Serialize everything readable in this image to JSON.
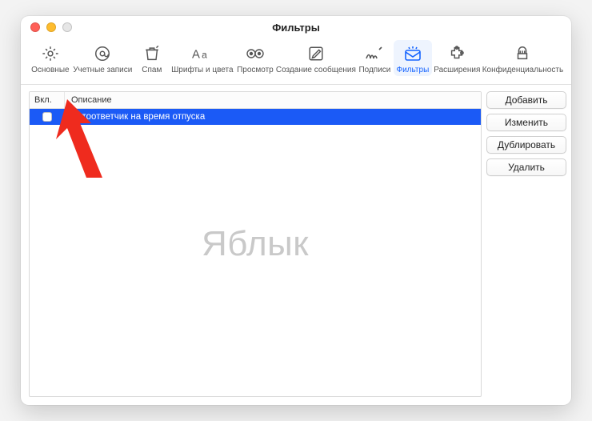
{
  "window": {
    "title": "Фильтры"
  },
  "toolbar": {
    "items": [
      {
        "id": "general",
        "label": "Основные"
      },
      {
        "id": "accounts",
        "label": "Учетные записи"
      },
      {
        "id": "junk",
        "label": "Спам"
      },
      {
        "id": "fonts",
        "label": "Шрифты и цвета"
      },
      {
        "id": "viewing",
        "label": "Просмотр"
      },
      {
        "id": "compose",
        "label": "Создание сообщения"
      },
      {
        "id": "sigs",
        "label": "Подписи"
      },
      {
        "id": "rules",
        "label": "Фильтры"
      },
      {
        "id": "ext",
        "label": "Расширения"
      },
      {
        "id": "privacy",
        "label": "Конфиденциальность"
      }
    ],
    "selected_index": 7
  },
  "list": {
    "headers": {
      "enabled": "Вкл.",
      "description": "Описание"
    },
    "rows": [
      {
        "enabled": false,
        "description": "Автоответчик на время отпуска",
        "selected": true
      }
    ]
  },
  "side_buttons": {
    "add": "Добавить",
    "edit": "Изменить",
    "duplicate": "Дублировать",
    "delete": "Удалить"
  },
  "watermark": "Яблык",
  "annotation": {
    "arrow_color": "#ef2b1e"
  },
  "icons": {
    "general": "gear-icon",
    "accounts": "at-icon",
    "junk": "bin-icon",
    "fonts": "aa-icon",
    "viewing": "eyes-icon",
    "compose": "compose-icon",
    "sigs": "signature-icon",
    "rules": "envelope-sparkle-icon",
    "ext": "puzzle-icon",
    "privacy": "hand-icon"
  }
}
